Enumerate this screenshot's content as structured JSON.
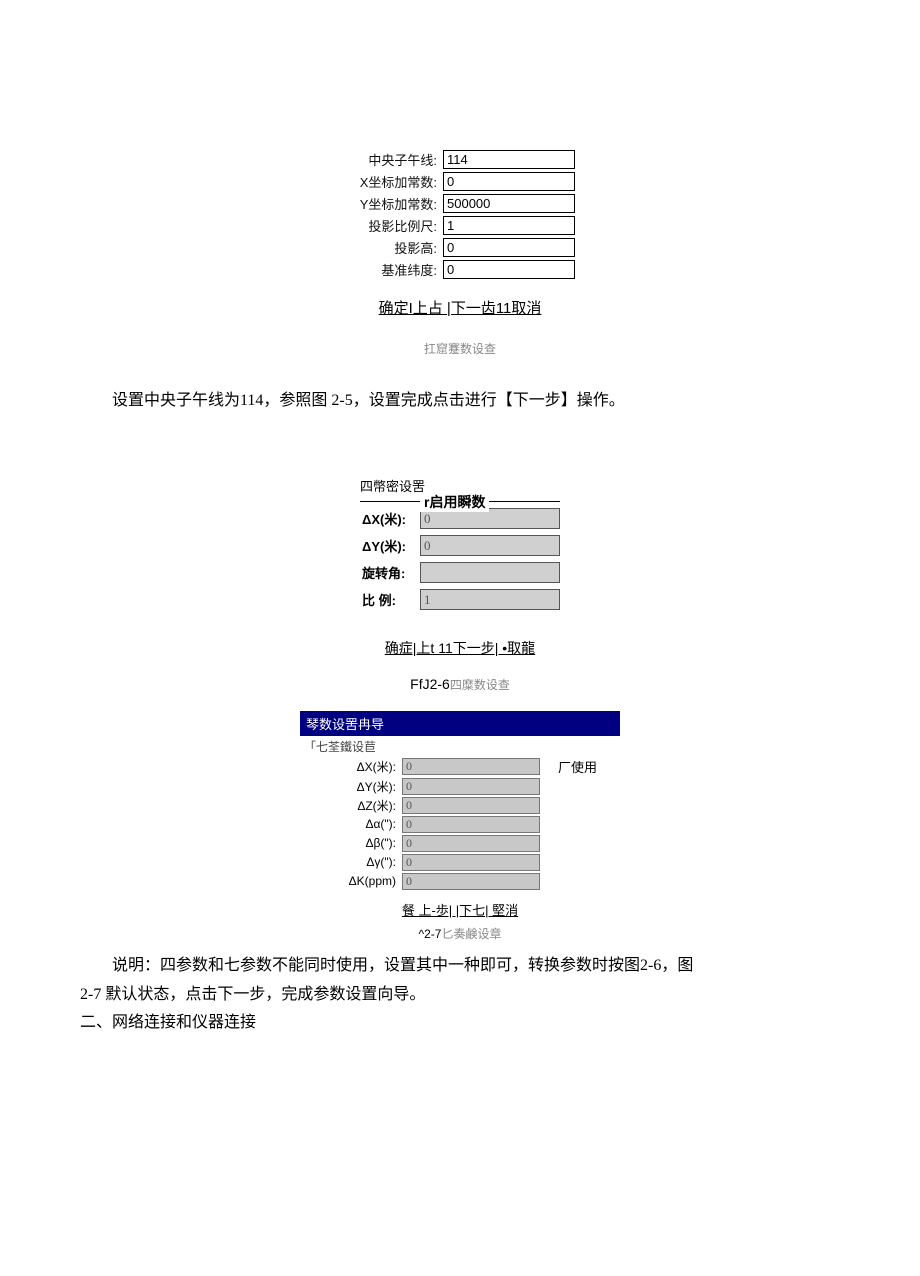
{
  "dialog1": {
    "rows": [
      {
        "label": "中央子午线:",
        "value": "114"
      },
      {
        "label": "X坐标加常数:",
        "value": "0"
      },
      {
        "label": "Y坐标加常数:",
        "value": "500000"
      },
      {
        "label": "投影比例尺:",
        "value": "1"
      },
      {
        "label": "投影高:",
        "value": "0"
      },
      {
        "label": "基准纬度:",
        "value": "0"
      }
    ],
    "buttons": "确定I上占 |下一齿11取消",
    "caption": "扛窟蹇数设查"
  },
  "para1": "设置中央子午线为114，参照图 2-5，设置完成点击进行【下一步】操作。",
  "dialog2": {
    "outer_title": "四幣密设罟",
    "group_label": "r启用瞬数",
    "rows": [
      {
        "label": "ΔX(米):",
        "value": "0"
      },
      {
        "label": "ΔY(米):",
        "value": "0"
      },
      {
        "label": "旋转角:",
        "value": ""
      },
      {
        "label": "比 例:",
        "value": "1"
      }
    ],
    "buttons": "确症|上t 11下一步| •取龍",
    "caption_prefix": "FfJ2-6",
    "caption_grey": "四糜数设查"
  },
  "dialog3": {
    "titlebar": "琴数设罟冉导",
    "group_label": "「七荃鐵设苣",
    "side_label": "厂使用",
    "rows": [
      {
        "label": "ΔX(米):",
        "value": "0"
      },
      {
        "label": "ΔY(米):",
        "value": "0"
      },
      {
        "label": "ΔZ(米):",
        "value": "0"
      },
      {
        "label": "Δα(\"):",
        "value": "0"
      },
      {
        "label": "Δβ(\"):",
        "value": "0"
      },
      {
        "label": "Δγ(\"):",
        "value": "0"
      },
      {
        "label": "ΔK(ppm)",
        "value": "0"
      }
    ],
    "buttons": "餐          上-歩| |下七| 堅消",
    "caption_prefix": "^2-7",
    "caption_grey": "匕奏鹸设章"
  },
  "para2_line1": "说明：四参数和七参数不能同时使用，设置其中一种即可，转换参数时按图2-6，图",
  "para2_line2": "2-7 默认状态，点击下一步，完成参数设置向导。",
  "para3": "二、网络连接和仪器连接"
}
